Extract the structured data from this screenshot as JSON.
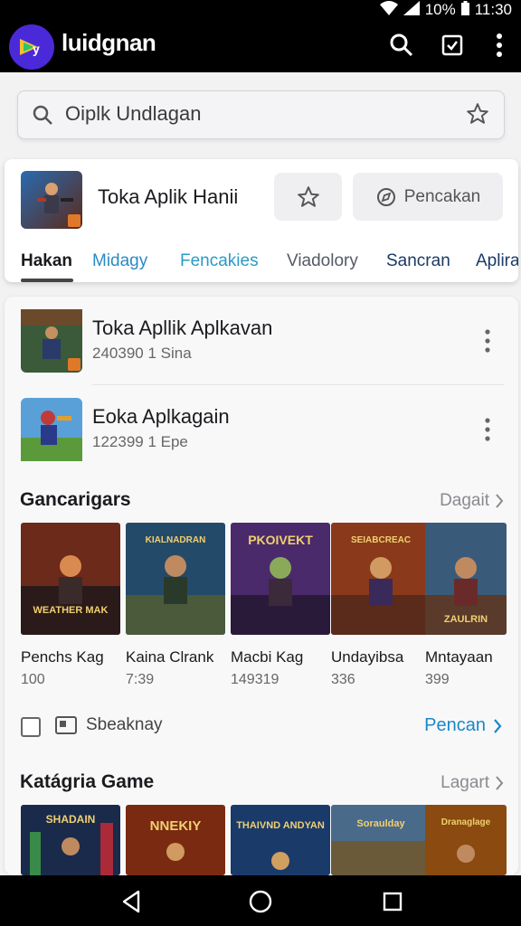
{
  "status": {
    "battery": "10%",
    "time": "11:30"
  },
  "appbar": {
    "title": "luidgnan",
    "icons": [
      "search-icon",
      "check-square-icon",
      "more-vert-icon"
    ]
  },
  "search": {
    "placeholder": "Oiplk Undlagan"
  },
  "featured": {
    "title": "Toka Aplik Hanii",
    "action_label": "Pencakan",
    "tabs": [
      "Hakan",
      "Midagy",
      "Fencakies",
      "Viadolory",
      "Sancran",
      "Aplira"
    ],
    "active_tab": "Hakan"
  },
  "list": [
    {
      "title": "Toka Apllik Aplkavan",
      "subtitle": "240390 1 Sina"
    },
    {
      "title": "Eoka Aplkagain",
      "subtitle": "122399 1 Epe"
    }
  ],
  "section1": {
    "title": "Gancarigars",
    "link": "Dagait",
    "tiles": [
      {
        "name": "Penchs Kag",
        "count": "100",
        "art": "WEATHER MAK",
        "color": "#6b2a1a"
      },
      {
        "name": "Kaina Clrank",
        "count": "7:39",
        "art": "KIALNADRAN",
        "color": "#244a6a"
      },
      {
        "name": "Macbi Kag",
        "count": "149319",
        "art": "PKOIVEKT",
        "color": "#4a2a6a"
      },
      {
        "name": "Undayibsa",
        "count": "336",
        "art": "SEIABCREAC",
        "color": "#8a3a1a"
      },
      {
        "name": "Mntayaan",
        "count": "399",
        "art": "ZAULRIN",
        "color": "#3a5a7a"
      }
    ],
    "check_label": "Sbeaknay",
    "action_label": "Pencan"
  },
  "section2": {
    "title": "Katágria Game",
    "link": "Lagart",
    "tiles": [
      {
        "art": "SHADAIN",
        "color": "#1a2a4a"
      },
      {
        "art": "NNEKIY",
        "color": "#7a2a10"
      },
      {
        "art": "THAIVND ANDYAN",
        "color": "#1a3a6a"
      },
      {
        "art": "Soraulday",
        "color": "#4a6a8a"
      },
      {
        "art": "Dranaglage",
        "color": "#8a4a10"
      }
    ]
  }
}
